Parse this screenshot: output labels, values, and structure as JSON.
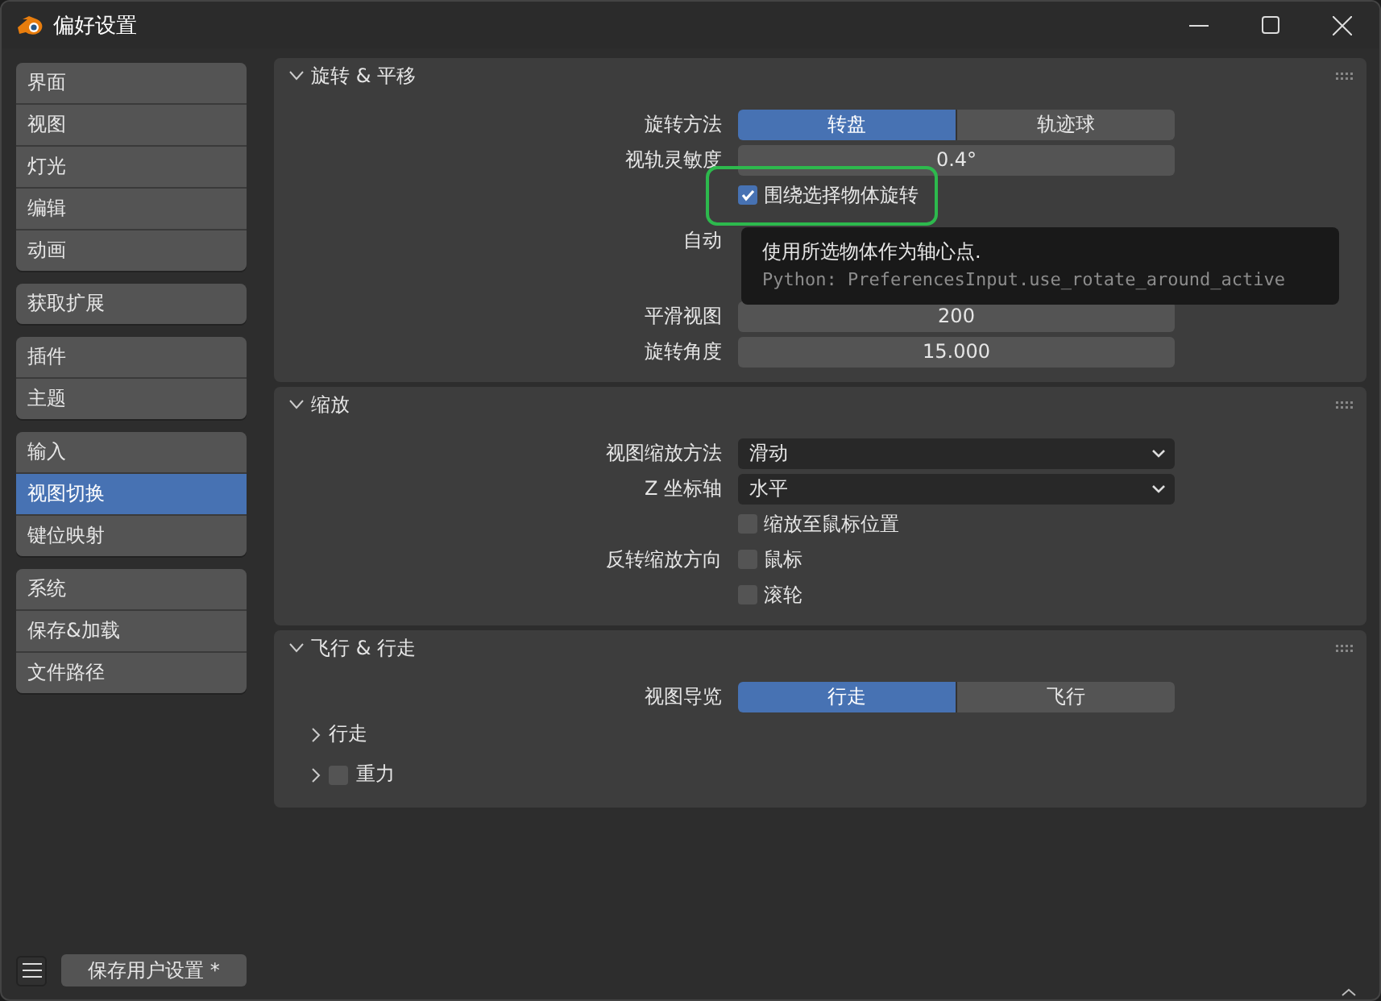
{
  "window": {
    "title": "偏好设置"
  },
  "sidebar": {
    "groups": [
      {
        "items": [
          {
            "label": "界面",
            "selected": false
          },
          {
            "label": "视图",
            "selected": false
          },
          {
            "label": "灯光",
            "selected": false
          },
          {
            "label": "编辑",
            "selected": false
          },
          {
            "label": "动画",
            "selected": false
          }
        ]
      },
      {
        "items": [
          {
            "label": "获取扩展",
            "selected": false
          }
        ]
      },
      {
        "items": [
          {
            "label": "插件",
            "selected": false
          },
          {
            "label": "主题",
            "selected": false
          }
        ]
      },
      {
        "items": [
          {
            "label": "输入",
            "selected": false
          },
          {
            "label": "视图切换",
            "selected": true
          },
          {
            "label": "键位映射",
            "selected": false
          }
        ]
      },
      {
        "items": [
          {
            "label": "系统",
            "selected": false
          },
          {
            "label": "保存&加载",
            "selected": false
          },
          {
            "label": "文件路径",
            "selected": false
          }
        ]
      }
    ]
  },
  "sections": [
    {
      "title": "旋转 & 平移",
      "expanded": true,
      "rows": [
        {
          "kind": "segmented",
          "label": "旋转方法",
          "options": [
            {
              "label": "转盘",
              "selected": true
            },
            {
              "label": "轨迹球",
              "selected": false
            }
          ]
        },
        {
          "kind": "number",
          "label": "视轨灵敏度",
          "value": "0.4°"
        },
        {
          "kind": "checkbox",
          "text": "围绕选择物体旋转",
          "checked": true,
          "highlighted": true
        },
        {
          "kind": "covered",
          "label": "自动"
        },
        {
          "kind": "number",
          "label": "平滑视图",
          "value": "200"
        },
        {
          "kind": "number",
          "label": "旋转角度",
          "value": "15.000"
        }
      ],
      "tooltip": {
        "text": "使用所选物体作为轴心点.",
        "python": "Python: PreferencesInput.use_rotate_around_active"
      }
    },
    {
      "title": "缩放",
      "expanded": true,
      "rows": [
        {
          "kind": "dropdown",
          "label": "视图缩放方法",
          "value": "滑动"
        },
        {
          "kind": "dropdown",
          "label": "Z 坐标轴",
          "value": "水平"
        },
        {
          "kind": "checkbox",
          "text": "缩放至鼠标位置",
          "checked": false
        },
        {
          "kind": "checkbox",
          "label": "反转缩放方向",
          "text": "鼠标",
          "checked": false
        },
        {
          "kind": "checkbox",
          "text": "滚轮",
          "checked": false
        }
      ]
    },
    {
      "title": "飞行 & 行走",
      "expanded": true,
      "rows": [
        {
          "kind": "segmented",
          "label": "视图导览",
          "options": [
            {
              "label": "行走",
              "selected": true
            },
            {
              "label": "飞行",
              "selected": false
            }
          ]
        },
        {
          "kind": "subpanel",
          "text": "行走",
          "expanded": false
        },
        {
          "kind": "subpanel",
          "text": "重力",
          "expanded": false,
          "checked": false
        }
      ]
    }
  ],
  "footer": {
    "save_button": "保存用户设置 *"
  }
}
